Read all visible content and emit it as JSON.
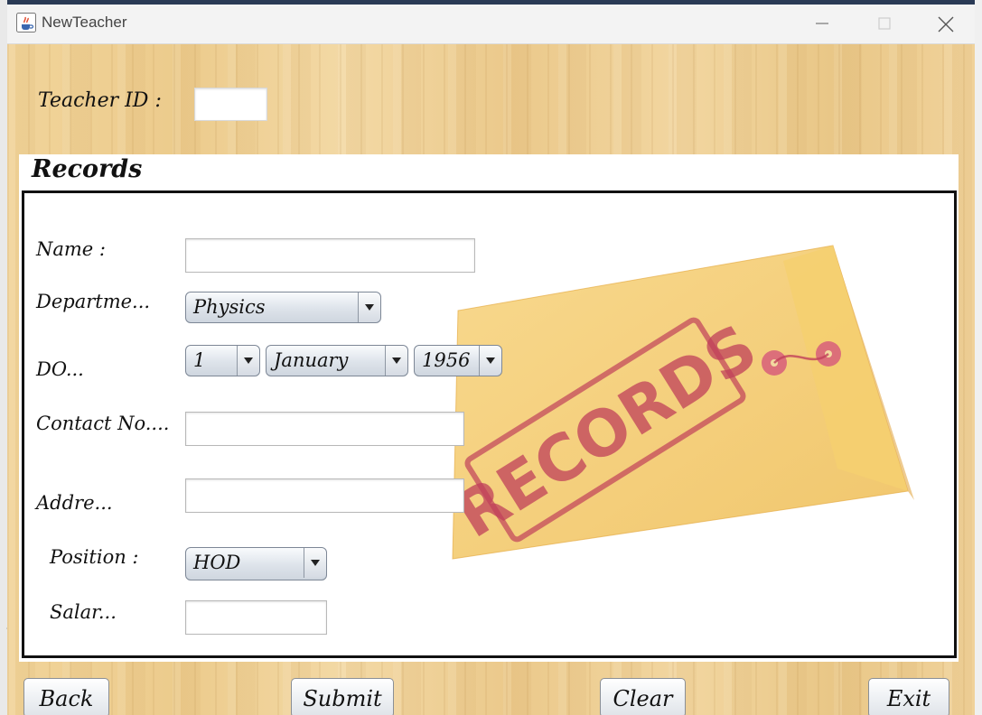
{
  "window": {
    "title": "NewTeacher",
    "icon": "java-cup-icon"
  },
  "background_label": "jL",
  "teacher_id": {
    "label": "Teacher ID :",
    "value": ""
  },
  "records": {
    "title": "Records",
    "stamp_text": "RECORDS",
    "fields": {
      "name": {
        "label": "Name :",
        "value": ""
      },
      "department": {
        "label": "Departme...",
        "selected": "Physics"
      },
      "dob": {
        "label": "DO...",
        "day": "1",
        "month": "January",
        "year": "1956"
      },
      "contact": {
        "label": "Contact No....",
        "value": ""
      },
      "address": {
        "label": "Addre...",
        "value": ""
      },
      "position": {
        "label": "Position :",
        "selected": "HOD"
      },
      "salary": {
        "label": "Salar...",
        "value": ""
      }
    }
  },
  "buttons": {
    "back": "Back",
    "submit": "Submit",
    "clear": "Clear",
    "exit": "Exit"
  },
  "colors": {
    "wood_background": "#f0d29a",
    "envelope": "#f1c25a",
    "stamp": "#c0405a",
    "panel_border": "#111111"
  }
}
